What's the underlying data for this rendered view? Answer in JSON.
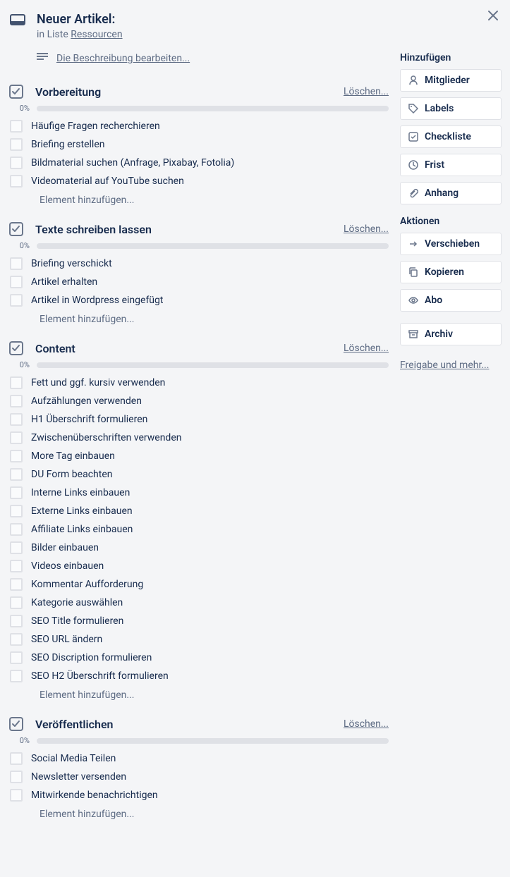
{
  "header": {
    "title": "Neuer Artikel:",
    "subtitle_prefix": "in Liste ",
    "subtitle_link": "Ressourcen"
  },
  "description": {
    "edit_link": "Die Beschreibung bearbeiten..."
  },
  "checklists": [
    {
      "title": "Vorbereitung",
      "delete_label": "Löschen...",
      "percent": "0%",
      "items": [
        "Häufige Fragen recherchieren",
        "Briefing erstellen",
        "Bildmaterial suchen (Anfrage, Pixabay, Fotolia)",
        "Videomaterial auf YouTube suchen"
      ],
      "add_label": "Element hinzufügen..."
    },
    {
      "title": "Texte schreiben lassen",
      "delete_label": "Löschen...",
      "percent": "0%",
      "items": [
        "Briefing verschickt",
        "Artikel erhalten",
        "Artikel in Wordpress eingefügt"
      ],
      "add_label": "Element hinzufügen..."
    },
    {
      "title": "Content",
      "delete_label": "Löschen...",
      "percent": "0%",
      "items": [
        "Fett und ggf. kursiv verwenden",
        "Aufzählungen verwenden",
        "H1 Überschrift formulieren",
        "Zwischenüberschriften verwenden",
        "More Tag einbauen",
        "DU Form beachten",
        "Interne Links einbauen",
        "Externe Links einbauen",
        "Affiliate Links einbauen",
        "Bilder einbauen",
        "Videos einbauen",
        "Kommentar Aufforderung",
        "Kategorie auswählen",
        "SEO Title formulieren",
        "SEO URL ändern",
        "SEO Discription formulieren",
        "SEO H2 Überschrift formulieren"
      ],
      "add_label": "Element hinzufügen..."
    },
    {
      "title": "Veröffentlichen",
      "delete_label": "Löschen...",
      "percent": "0%",
      "items": [
        "Social Media Teilen",
        "Newsletter versenden",
        "Mitwirkende benachrichtigen"
      ],
      "add_label": "Element hinzufügen..."
    }
  ],
  "sidebar": {
    "add_heading": "Hinzufügen",
    "add_buttons": [
      {
        "icon": "user-icon",
        "label": "Mitglieder"
      },
      {
        "icon": "tag-icon",
        "label": "Labels"
      },
      {
        "icon": "checklist-icon",
        "label": "Checkliste"
      },
      {
        "icon": "clock-icon",
        "label": "Frist"
      },
      {
        "icon": "attachment-icon",
        "label": "Anhang"
      }
    ],
    "actions_heading": "Aktionen",
    "action_buttons": [
      {
        "icon": "move-icon",
        "label": "Verschieben"
      },
      {
        "icon": "copy-icon",
        "label": "Kopieren"
      },
      {
        "icon": "eye-icon",
        "label": "Abo"
      },
      {
        "icon": "archive-icon",
        "label": "Archiv"
      }
    ],
    "share_link": "Freigabe und mehr..."
  }
}
